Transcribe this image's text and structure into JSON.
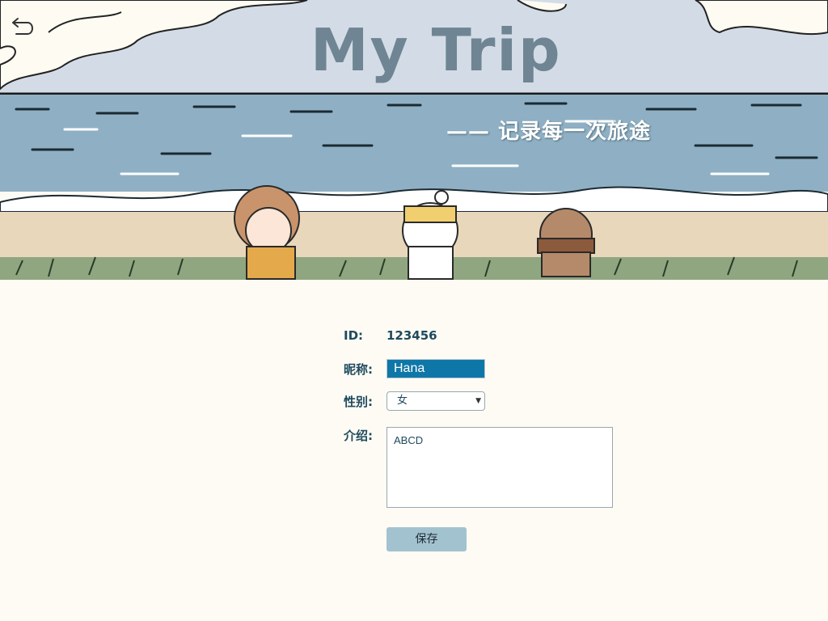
{
  "banner": {
    "title": "My Trip",
    "subtitle": "—— 记录每一次旅途"
  },
  "icons": {
    "back": "back-arrow-icon",
    "dropdown": "chevron-down-icon"
  },
  "colors": {
    "background": "#fdfbf4",
    "label": "#1f4a5e",
    "title": "#6f8593",
    "input_selected_bg": "#0f77a8",
    "save_button_bg": "#a3c2d0",
    "sea": "#8fb0c4",
    "sand": "#e8d7bb"
  },
  "profile": {
    "id_label": "ID:",
    "id_value": "123456",
    "nickname_label": "昵称:",
    "nickname_value": "Hana",
    "gender_label": "性别:",
    "gender_value": "女",
    "intro_label": "介绍:",
    "intro_value": "ABCD",
    "save_label": "保存"
  }
}
